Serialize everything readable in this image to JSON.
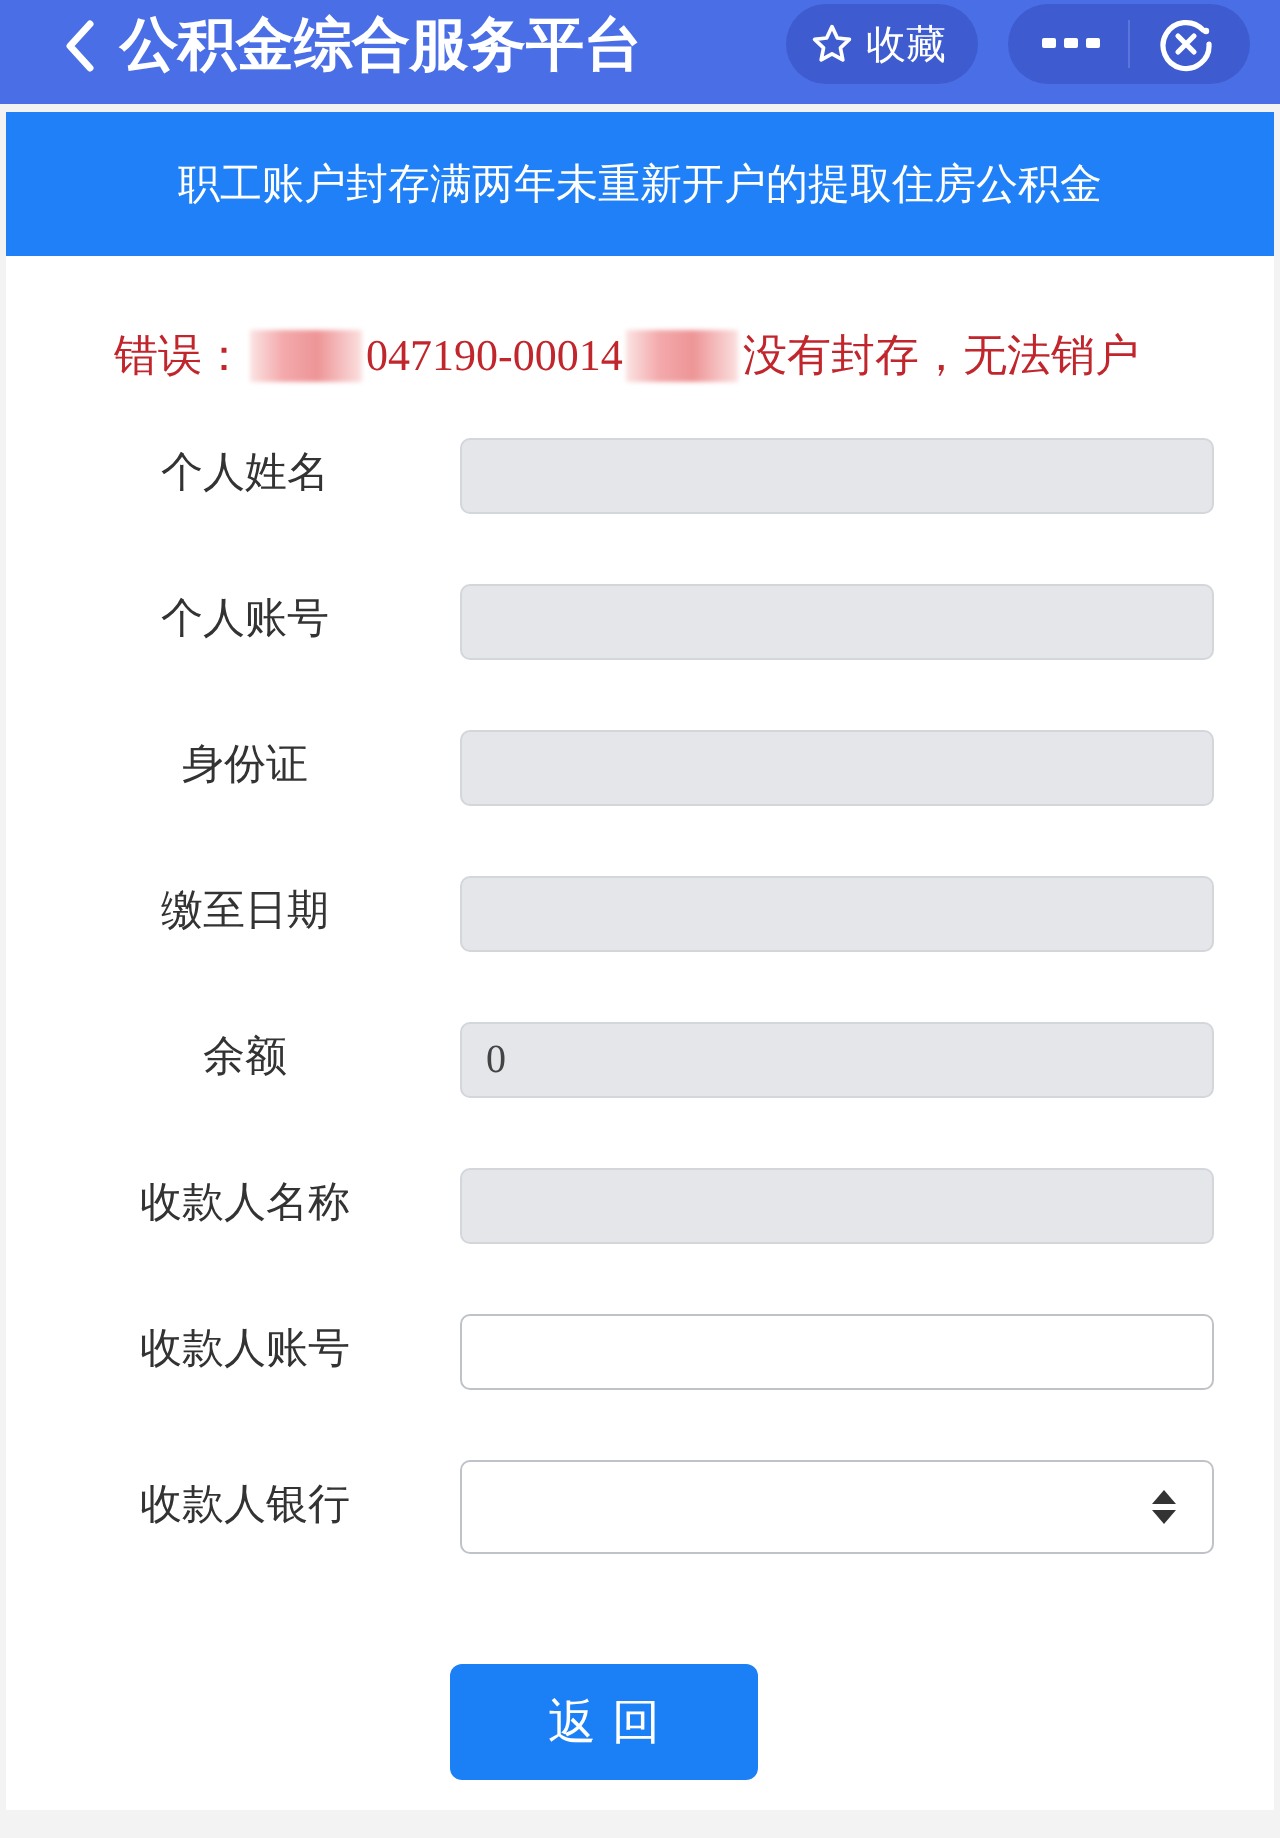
{
  "nav": {
    "title": "公积金综合服务平台",
    "favorite": {
      "label": "收藏"
    }
  },
  "banner": {
    "title": "职工账户封存满两年未重新开户的提取住房公积金"
  },
  "error": {
    "segments": [
      {
        "kind": "text",
        "text": "错误："
      },
      {
        "kind": "redacted"
      },
      {
        "kind": "text",
        "text": "047190-00014"
      },
      {
        "kind": "redacted"
      },
      {
        "kind": "text",
        "text": "没有封存，无法销户"
      }
    ]
  },
  "fields": [
    {
      "label": "个人姓名",
      "kind": "text",
      "disabled": true
    },
    {
      "label": "个人账号",
      "kind": "text",
      "disabled": true
    },
    {
      "label": "身份证",
      "kind": "text",
      "disabled": true
    },
    {
      "label": "缴至日期",
      "kind": "text",
      "disabled": true
    },
    {
      "label": "余额",
      "kind": "text",
      "disabled": true,
      "value": "0"
    },
    {
      "label": "收款人名称",
      "kind": "text",
      "disabled": true
    },
    {
      "label": "收款人账号",
      "kind": "text",
      "disabled": false
    },
    {
      "label": "收款人银行",
      "kind": "select",
      "disabled": false
    }
  ],
  "buttons": [
    {
      "label": "返 回"
    }
  ]
}
